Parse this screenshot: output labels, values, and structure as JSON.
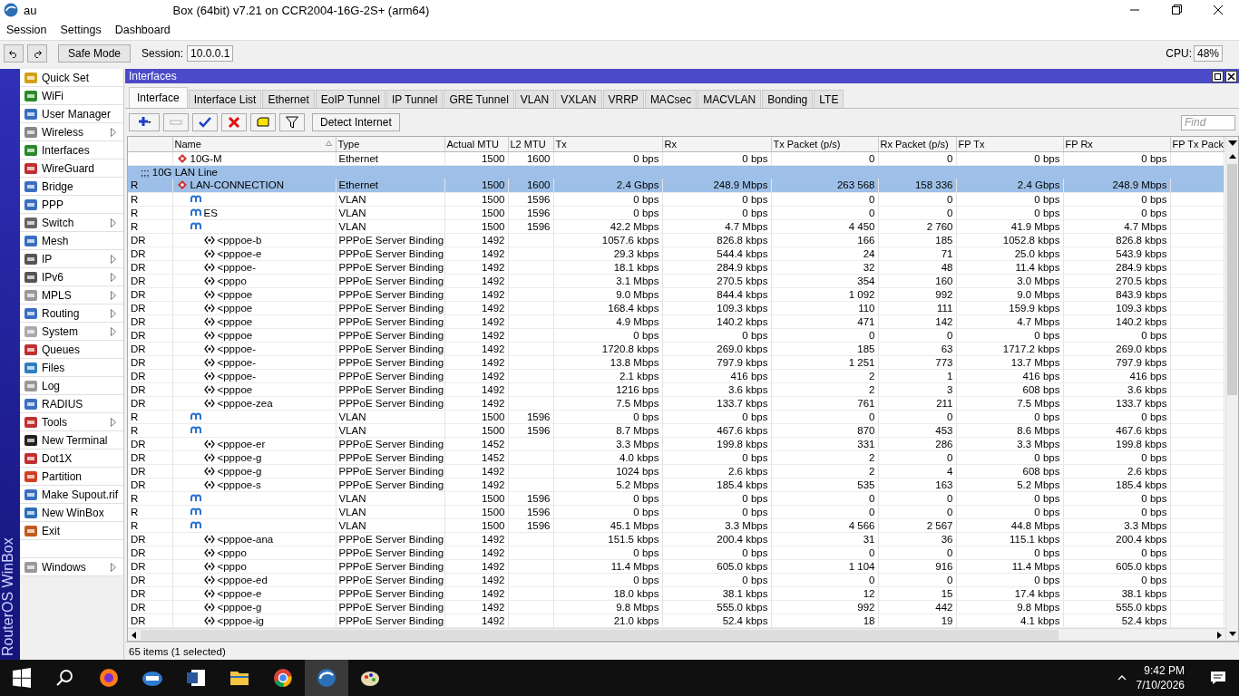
{
  "window": {
    "title_parts": [
      "au",
      "Box (64bit) v7.21 on CCR2004-16G-2S+ (arm64)"
    ]
  },
  "menu": [
    "Session",
    "Settings",
    "Dashboard"
  ],
  "toolbar": {
    "safe_mode": "Safe Mode",
    "session_label": "Session:",
    "session": "10.0.0.1",
    "cpu_label": "CPU:",
    "cpu": "48%"
  },
  "brand": "RouterOS WinBox",
  "sidebar": {
    "items": [
      {
        "label": "Quick Set",
        "submenu": false
      },
      {
        "label": "WiFi",
        "submenu": false
      },
      {
        "label": "User Manager",
        "submenu": false
      },
      {
        "label": "Wireless",
        "submenu": true
      },
      {
        "label": "Interfaces",
        "submenu": false
      },
      {
        "label": "WireGuard",
        "submenu": false
      },
      {
        "label": "Bridge",
        "submenu": false
      },
      {
        "label": "PPP",
        "submenu": false
      },
      {
        "label": "Switch",
        "submenu": true
      },
      {
        "label": "Mesh",
        "submenu": false
      },
      {
        "label": "IP",
        "submenu": true
      },
      {
        "label": "IPv6",
        "submenu": true
      },
      {
        "label": "MPLS",
        "submenu": true
      },
      {
        "label": "Routing",
        "submenu": true
      },
      {
        "label": "System",
        "submenu": true
      },
      {
        "label": "Queues",
        "submenu": false
      },
      {
        "label": "Files",
        "submenu": false
      },
      {
        "label": "Log",
        "submenu": false
      },
      {
        "label": "RADIUS",
        "submenu": false
      },
      {
        "label": "Tools",
        "submenu": true
      },
      {
        "label": "New Terminal",
        "submenu": false
      },
      {
        "label": "Dot1X",
        "submenu": false
      },
      {
        "label": "Partition",
        "submenu": false
      },
      {
        "label": "Make Supout.rif",
        "submenu": false
      },
      {
        "label": "New WinBox",
        "submenu": false
      },
      {
        "label": "Exit",
        "submenu": false
      }
    ],
    "footer": {
      "label": "Windows",
      "submenu": true
    }
  },
  "interfaces_window": {
    "title": "Interfaces",
    "tabs": [
      {
        "label": "Interface",
        "selected": true
      },
      {
        "label": "Interface List",
        "selected": false
      },
      {
        "label": "Ethernet",
        "selected": false
      },
      {
        "label": "EoIP Tunnel",
        "selected": false
      },
      {
        "label": "IP Tunnel",
        "selected": false
      },
      {
        "label": "GRE Tunnel",
        "selected": false
      },
      {
        "label": "VLAN",
        "selected": false
      },
      {
        "label": "VXLAN",
        "selected": false
      },
      {
        "label": "VRRP",
        "selected": false
      },
      {
        "label": "MACsec",
        "selected": false
      },
      {
        "label": "MACVLAN",
        "selected": false
      },
      {
        "label": "Bonding",
        "selected": false
      },
      {
        "label": "LTE",
        "selected": false
      }
    ],
    "tools": [
      {
        "kind": "add",
        "disabled": false
      },
      {
        "kind": "remove",
        "disabled": true
      },
      {
        "kind": "enable",
        "disabled": false
      },
      {
        "kind": "disable",
        "disabled": false
      },
      {
        "kind": "comment",
        "disabled": false
      },
      {
        "kind": "filter",
        "disabled": false
      }
    ],
    "detect_button": "Detect Internet",
    "find": {
      "placeholder": "Find"
    },
    "table": {
      "columns": [
        "Name",
        "Type",
        "Actual MTU",
        "L2 MTU",
        "Tx",
        "Rx",
        "Tx Packet (p/s)",
        "Rx Packet (p/s)",
        "FP Tx",
        "FP Rx",
        "FP Tx Pack"
      ],
      "rows": [
        {
          "kind": "ethernet",
          "name": "10G-M",
          "type": "Ethernet",
          "mtu": "1500",
          "l2_mtu": "1600",
          "values": [
            "0 bps",
            "0 bps",
            "0",
            "0",
            "0 bps",
            "0 bps"
          ],
          "selected": false
        },
        {
          "kind": "ethernet",
          "flags": "R",
          "comment": ";;; 10G LAN Line",
          "name": "LAN-CONNECTION",
          "type": "Ethernet",
          "mtu": "1500",
          "l2_mtu": "1600",
          "values": [
            "2.4 Gbps",
            "248.9 Mbps",
            "263 568",
            "158 336",
            "2.4 Gbps",
            "248.9 Mbps"
          ],
          "selected": true,
          "children": [
            {
              "kind": "vlan",
              "flags": "R",
              "type": "VLAN",
              "mtu": "1500",
              "l2_mtu": "1596",
              "values": [
                "0 bps",
                "0 bps",
                "0",
                "0",
                "0 bps",
                "0 bps"
              ],
              "selected": false
            },
            {
              "kind": "vlan",
              "flags": "R",
              "name": "ES",
              "type": "VLAN",
              "mtu": "1500",
              "l2_mtu": "1596",
              "values": [
                "0 bps",
                "0 bps",
                "0",
                "0",
                "0 bps",
                "0 bps"
              ],
              "selected": false
            },
            {
              "kind": "vlan",
              "flags": "R",
              "type": "VLAN",
              "mtu": "1500",
              "l2_mtu": "1596",
              "values": [
                "42.2 Mbps",
                "4.7 Mbps",
                "4 450",
                "2 760",
                "41.9 Mbps",
                "4.7 Mbps"
              ],
              "selected": false,
              "children": [
                {
                  "kind": "pppoe",
                  "flags": "DR",
                  "name": "<pppoe-b",
                  "type": "PPPoE Server Binding",
                  "mtu": "1492",
                  "values": [
                    "1057.6 kbps",
                    "826.8 kbps",
                    "166",
                    "185",
                    "1052.8 kbps",
                    "826.8 kbps"
                  ],
                  "selected": false
                },
                {
                  "kind": "pppoe",
                  "flags": "DR",
                  "name": "<pppoe-e",
                  "type": "PPPoE Server Binding",
                  "mtu": "1492",
                  "values": [
                    "29.3 kbps",
                    "544.4 kbps",
                    "24",
                    "71",
                    "25.0 kbps",
                    "543.9 kbps"
                  ],
                  "selected": false
                },
                {
                  "kind": "pppoe",
                  "flags": "DR",
                  "name": "<pppoe-",
                  "type": "PPPoE Server Binding",
                  "mtu": "1492",
                  "values": [
                    "18.1 kbps",
                    "284.9 kbps",
                    "32",
                    "48",
                    "11.4 kbps",
                    "284.9 kbps"
                  ],
                  "selected": false
                },
                {
                  "kind": "pppoe",
                  "flags": "DR",
                  "name": "<pppo",
                  "type": "PPPoE Server Binding",
                  "mtu": "1492",
                  "values": [
                    "3.1 Mbps",
                    "270.5 kbps",
                    "354",
                    "160",
                    "3.0 Mbps",
                    "270.5 kbps"
                  ],
                  "selected": false
                },
                {
                  "kind": "pppoe",
                  "flags": "DR",
                  "name": "<pppoe",
                  "type": "PPPoE Server Binding",
                  "mtu": "1492",
                  "values": [
                    "9.0 Mbps",
                    "844.4 kbps",
                    "1 092",
                    "992",
                    "9.0 Mbps",
                    "843.9 kbps"
                  ],
                  "selected": false
                },
                {
                  "kind": "pppoe",
                  "flags": "DR",
                  "name": "<pppoe",
                  "type": "PPPoE Server Binding",
                  "mtu": "1492",
                  "values": [
                    "168.4 kbps",
                    "109.3 kbps",
                    "110",
                    "111",
                    "159.9 kbps",
                    "109.3 kbps"
                  ],
                  "selected": false
                },
                {
                  "kind": "pppoe",
                  "flags": "DR",
                  "name": "<pppoe",
                  "type": "PPPoE Server Binding",
                  "mtu": "1492",
                  "values": [
                    "4.9 Mbps",
                    "140.2 kbps",
                    "471",
                    "142",
                    "4.7 Mbps",
                    "140.2 kbps"
                  ],
                  "selected": false
                },
                {
                  "kind": "pppoe",
                  "flags": "DR",
                  "name": "<pppoe",
                  "type": "PPPoE Server Binding",
                  "mtu": "1492",
                  "values": [
                    "0 bps",
                    "0 bps",
                    "0",
                    "0",
                    "0 bps",
                    "0 bps"
                  ],
                  "selected": false
                },
                {
                  "kind": "pppoe",
                  "flags": "DR",
                  "name": "<pppoe-",
                  "type": "PPPoE Server Binding",
                  "mtu": "1492",
                  "values": [
                    "1720.8 kbps",
                    "269.0 kbps",
                    "185",
                    "63",
                    "1717.2 kbps",
                    "269.0 kbps"
                  ],
                  "selected": false
                },
                {
                  "kind": "pppoe",
                  "flags": "DR",
                  "name": "<pppoe-",
                  "type": "PPPoE Server Binding",
                  "mtu": "1492",
                  "values": [
                    "13.8 Mbps",
                    "797.9 kbps",
                    "1 251",
                    "773",
                    "13.7 Mbps",
                    "797.9 kbps"
                  ],
                  "selected": false
                },
                {
                  "kind": "pppoe",
                  "flags": "DR",
                  "name": "<pppoe-",
                  "type": "PPPoE Server Binding",
                  "mtu": "1492",
                  "values": [
                    "2.1 kbps",
                    "416 bps",
                    "2",
                    "1",
                    "416 bps",
                    "416 bps"
                  ],
                  "selected": false
                },
                {
                  "kind": "pppoe",
                  "flags": "DR",
                  "name": "<pppoe",
                  "type": "PPPoE Server Binding",
                  "mtu": "1492",
                  "values": [
                    "1216 bps",
                    "3.6 kbps",
                    "2",
                    "3",
                    "608 bps",
                    "3.6 kbps"
                  ],
                  "selected": false
                },
                {
                  "kind": "pppoe",
                  "flags": "DR",
                  "name": "<pppoe-zea",
                  "type": "PPPoE Server Binding",
                  "mtu": "1492",
                  "values": [
                    "7.5 Mbps",
                    "133.7 kbps",
                    "761",
                    "211",
                    "7.5 Mbps",
                    "133.7 kbps"
                  ],
                  "selected": false
                }
              ]
            },
            {
              "kind": "vlan",
              "flags": "R",
              "type": "VLAN",
              "mtu": "1500",
              "l2_mtu": "1596",
              "values": [
                "0 bps",
                "0 bps",
                "0",
                "0",
                "0 bps",
                "0 bps"
              ],
              "selected": false
            },
            {
              "kind": "vlan",
              "flags": "R",
              "type": "VLAN",
              "mtu": "1500",
              "l2_mtu": "1596",
              "values": [
                "8.7 Mbps",
                "467.6 kbps",
                "870",
                "453",
                "8.6 Mbps",
                "467.6 kbps"
              ],
              "selected": false,
              "children": [
                {
                  "kind": "pppoe",
                  "flags": "DR",
                  "name": "<pppoe-er",
                  "type": "PPPoE Server Binding",
                  "mtu": "1452",
                  "values": [
                    "3.3 Mbps",
                    "199.8 kbps",
                    "331",
                    "286",
                    "3.3 Mbps",
                    "199.8 kbps"
                  ],
                  "selected": false
                },
                {
                  "kind": "pppoe",
                  "flags": "DR",
                  "name": "<pppoe-g",
                  "type": "PPPoE Server Binding",
                  "mtu": "1452",
                  "values": [
                    "4.0 kbps",
                    "0 bps",
                    "2",
                    "0",
                    "0 bps",
                    "0 bps"
                  ],
                  "selected": false
                },
                {
                  "kind": "pppoe",
                  "flags": "DR",
                  "name": "<pppoe-g",
                  "type": "PPPoE Server Binding",
                  "mtu": "1492",
                  "values": [
                    "1024 bps",
                    "2.6 kbps",
                    "2",
                    "4",
                    "608 bps",
                    "2.6 kbps"
                  ],
                  "selected": false
                },
                {
                  "kind": "pppoe",
                  "flags": "DR",
                  "name": "<pppoe-s",
                  "type": "PPPoE Server Binding",
                  "mtu": "1492",
                  "values": [
                    "5.2 Mbps",
                    "185.4 kbps",
                    "535",
                    "163",
                    "5.2 Mbps",
                    "185.4 kbps"
                  ],
                  "selected": false
                }
              ]
            },
            {
              "kind": "vlan",
              "flags": "R",
              "type": "VLAN",
              "mtu": "1500",
              "l2_mtu": "1596",
              "values": [
                "0 bps",
                "0 bps",
                "0",
                "0",
                "0 bps",
                "0 bps"
              ],
              "selected": false
            },
            {
              "kind": "vlan",
              "flags": "R",
              "type": "VLAN",
              "mtu": "1500",
              "l2_mtu": "1596",
              "values": [
                "0 bps",
                "0 bps",
                "0",
                "0",
                "0 bps",
                "0 bps"
              ],
              "selected": false
            },
            {
              "kind": "vlan",
              "flags": "R",
              "type": "VLAN",
              "mtu": "1500",
              "l2_mtu": "1596",
              "values": [
                "45.1 Mbps",
                "3.3 Mbps",
                "4 566",
                "2 567",
                "44.8 Mbps",
                "3.3 Mbps"
              ],
              "selected": false,
              "children": [
                {
                  "kind": "pppoe",
                  "flags": "DR",
                  "name": "<pppoe-ana",
                  "type": "PPPoE Server Binding",
                  "mtu": "1492",
                  "values": [
                    "151.5 kbps",
                    "200.4 kbps",
                    "31",
                    "36",
                    "115.1 kbps",
                    "200.4 kbps"
                  ],
                  "selected": false
                },
                {
                  "kind": "pppoe",
                  "flags": "DR",
                  "name": "<pppo",
                  "type": "PPPoE Server Binding",
                  "mtu": "1492",
                  "values": [
                    "0 bps",
                    "0 bps",
                    "0",
                    "0",
                    "0 bps",
                    "0 bps"
                  ],
                  "selected": false
                },
                {
                  "kind": "pppoe",
                  "flags": "DR",
                  "name": "<pppo",
                  "type": "PPPoE Server Binding",
                  "mtu": "1492",
                  "values": [
                    "11.4 Mbps",
                    "605.0 kbps",
                    "1 104",
                    "916",
                    "11.4 Mbps",
                    "605.0 kbps"
                  ],
                  "selected": false
                },
                {
                  "kind": "pppoe",
                  "flags": "DR",
                  "name": "<pppoe-ed",
                  "type": "PPPoE Server Binding",
                  "mtu": "1492",
                  "values": [
                    "0 bps",
                    "0 bps",
                    "0",
                    "0",
                    "0 bps",
                    "0 bps"
                  ],
                  "selected": false
                },
                {
                  "kind": "pppoe",
                  "flags": "DR",
                  "name": "<pppoe-e",
                  "type": "PPPoE Server Binding",
                  "mtu": "1492",
                  "values": [
                    "18.0 kbps",
                    "38.1 kbps",
                    "12",
                    "15",
                    "17.4 kbps",
                    "38.1 kbps"
                  ],
                  "selected": false
                },
                {
                  "kind": "pppoe",
                  "flags": "DR",
                  "name": "<pppoe-g",
                  "type": "PPPoE Server Binding",
                  "mtu": "1492",
                  "values": [
                    "9.8 Mbps",
                    "555.0 kbps",
                    "992",
                    "442",
                    "9.8 Mbps",
                    "555.0 kbps"
                  ],
                  "selected": false
                },
                {
                  "kind": "pppoe",
                  "flags": "DR",
                  "name": "<pppoe-ig",
                  "type": "PPPoE Server Binding",
                  "mtu": "1492",
                  "values": [
                    "21.0 kbps",
                    "52.4 kbps",
                    "18",
                    "19",
                    "4.1 kbps",
                    "52.4 kbps"
                  ],
                  "selected": false
                }
              ]
            }
          ]
        }
      ]
    },
    "status": "65 items (1 selected)"
  },
  "taskbar": {
    "time": "9:42 PM",
    "date": "7/10/2026"
  }
}
